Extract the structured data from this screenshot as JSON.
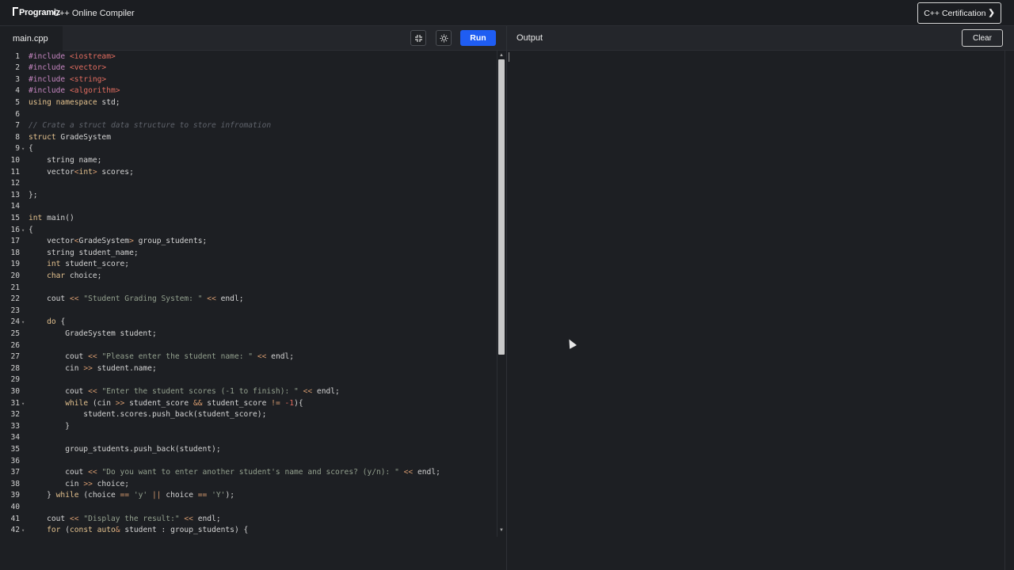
{
  "header": {
    "logo": "Programiz",
    "title": "C++ Online Compiler",
    "certification_label": "C++ Certification",
    "certification_chevron": "❯"
  },
  "editor": {
    "file_tab": "main.cpp",
    "fullscreen_icon": "expand-icon",
    "theme_icon": "sun-icon",
    "run_label": "Run"
  },
  "output": {
    "title": "Output",
    "clear_label": "Clear"
  }
}
